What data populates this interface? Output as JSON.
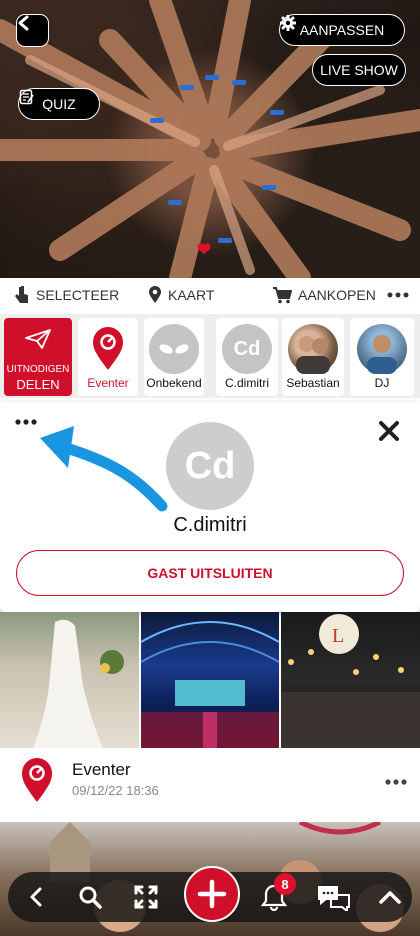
{
  "hero": {
    "customize_label": "AANPASSEN",
    "live_show_label": "LIVE SHOW",
    "quiz_label": "QUIZ"
  },
  "actions": {
    "select": "SELECTEER",
    "map": "KAART",
    "buy": "AANKOPEN"
  },
  "strip": {
    "invite_line1": "UITNODIGEN",
    "invite_line2": "DELEN",
    "guests": [
      {
        "name": "Eventer"
      },
      {
        "name": "Onbekend"
      },
      {
        "name": "C.dimitri",
        "initials": "Cd"
      },
      {
        "name": "Sebastian"
      },
      {
        "name": "DJ"
      }
    ]
  },
  "popup": {
    "initials": "Cd",
    "name": "C.dimitri",
    "exclude_label": "GAST UITSLUITEN"
  },
  "post": {
    "author": "Eventer",
    "timestamp": "09/12/22 18:36"
  },
  "nav": {
    "notification_count": "8"
  },
  "colors": {
    "accent": "#d0102a",
    "arrow": "#1a96e0"
  }
}
